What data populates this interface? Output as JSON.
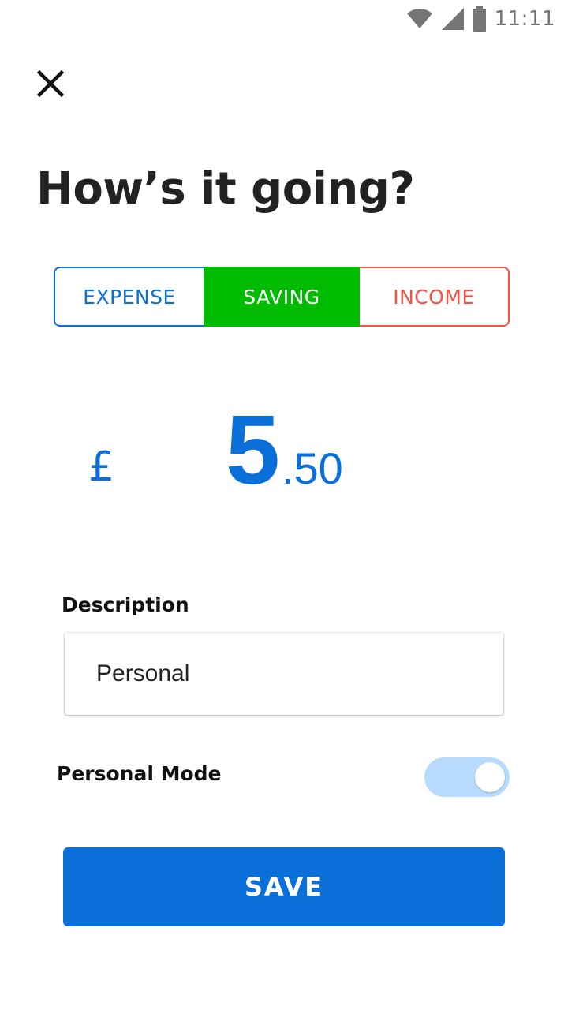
{
  "status_bar": {
    "time": "11:11",
    "icons": [
      "wifi-icon",
      "cellular-signal-icon",
      "battery-icon"
    ]
  },
  "header": {
    "close_icon": "close-icon",
    "title": "How’s it going?"
  },
  "type_selector": {
    "options": [
      {
        "label": "EXPENSE",
        "color": "#0b6fd9",
        "selected": false
      },
      {
        "label": "SAVING",
        "color": "#00bb00",
        "selected": true
      },
      {
        "label": "INCOME",
        "color": "#f05343",
        "selected": false
      }
    ]
  },
  "amount": {
    "currency": "£",
    "whole": "5",
    "decimal": ".50",
    "color": "#0b6fd9"
  },
  "description": {
    "label": "Description",
    "value": "Personal"
  },
  "personal_mode": {
    "label": "Personal Mode",
    "enabled": true
  },
  "save_button": {
    "label": "SAVE",
    "color": "#0b6fd9"
  }
}
